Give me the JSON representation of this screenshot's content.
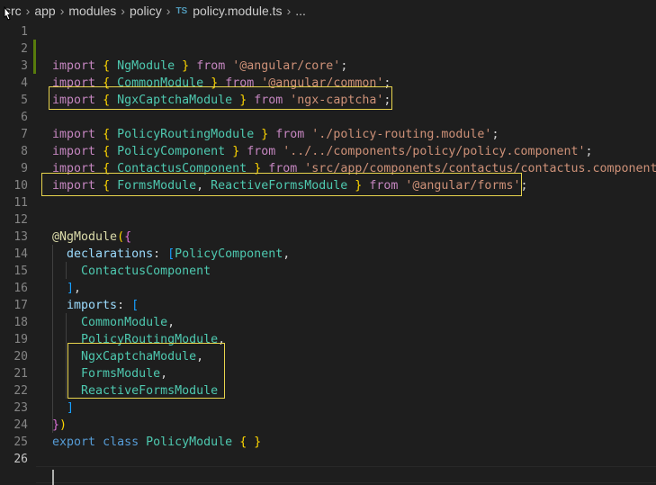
{
  "breadcrumb": {
    "items": [
      "src",
      "app",
      "modules",
      "policy"
    ],
    "file_icon": "TS",
    "file": "policy.module.ts",
    "more": "..."
  },
  "colors": {
    "background": "#1e1e1e",
    "highlight_box": "#e8d44d",
    "keyword": "#c586c0",
    "class_name": "#4ec9b0",
    "string": "#ce9178"
  },
  "editor": {
    "active_line": "26",
    "lines": [
      {
        "n": "1",
        "t": []
      },
      {
        "n": "2",
        "t": []
      },
      {
        "n": "3",
        "t": [
          [
            "kw",
            "import"
          ],
          [
            "pl",
            " "
          ],
          [
            "br1",
            "{"
          ],
          [
            "pl",
            " "
          ],
          [
            "cls",
            "NgModule"
          ],
          [
            "pl",
            " "
          ],
          [
            "br1",
            "}"
          ],
          [
            "pl",
            " "
          ],
          [
            "kw",
            "from"
          ],
          [
            "pl",
            " "
          ],
          [
            "str",
            "'@angular/core'"
          ],
          [
            "pl",
            ";"
          ]
        ]
      },
      {
        "n": "4",
        "t": [
          [
            "kw",
            "import"
          ],
          [
            "pl",
            " "
          ],
          [
            "br1",
            "{"
          ],
          [
            "pl",
            " "
          ],
          [
            "cls",
            "CommonModule"
          ],
          [
            "pl",
            " "
          ],
          [
            "br1",
            "}"
          ],
          [
            "pl",
            " "
          ],
          [
            "kw",
            "from"
          ],
          [
            "pl",
            " "
          ],
          [
            "str",
            "'@angular/common'"
          ],
          [
            "pl",
            ";"
          ]
        ]
      },
      {
        "n": "5",
        "t": [
          [
            "kw",
            "import"
          ],
          [
            "pl",
            " "
          ],
          [
            "br1",
            "{"
          ],
          [
            "pl",
            " "
          ],
          [
            "cls",
            "NgxCaptchaModule"
          ],
          [
            "pl",
            " "
          ],
          [
            "br1",
            "}"
          ],
          [
            "pl",
            " "
          ],
          [
            "kw",
            "from"
          ],
          [
            "pl",
            " "
          ],
          [
            "str",
            "'ngx-captcha'"
          ],
          [
            "pl",
            ";"
          ]
        ]
      },
      {
        "n": "6",
        "t": []
      },
      {
        "n": "7",
        "t": [
          [
            "kw",
            "import"
          ],
          [
            "pl",
            " "
          ],
          [
            "br1",
            "{"
          ],
          [
            "pl",
            " "
          ],
          [
            "cls",
            "PolicyRoutingModule"
          ],
          [
            "pl",
            " "
          ],
          [
            "br1",
            "}"
          ],
          [
            "pl",
            " "
          ],
          [
            "kw",
            "from"
          ],
          [
            "pl",
            " "
          ],
          [
            "str",
            "'./policy-routing.module'"
          ],
          [
            "pl",
            ";"
          ]
        ]
      },
      {
        "n": "8",
        "t": [
          [
            "kw",
            "import"
          ],
          [
            "pl",
            " "
          ],
          [
            "br1",
            "{"
          ],
          [
            "pl",
            " "
          ],
          [
            "cls",
            "PolicyComponent"
          ],
          [
            "pl",
            " "
          ],
          [
            "br1",
            "}"
          ],
          [
            "pl",
            " "
          ],
          [
            "kw",
            "from"
          ],
          [
            "pl",
            " "
          ],
          [
            "str",
            "'../../components/policy/policy.component'"
          ],
          [
            "pl",
            ";"
          ]
        ]
      },
      {
        "n": "9",
        "t": [
          [
            "kw",
            "import"
          ],
          [
            "pl",
            " "
          ],
          [
            "br1",
            "{"
          ],
          [
            "pl",
            " "
          ],
          [
            "cls",
            "ContactusComponent"
          ],
          [
            "pl",
            " "
          ],
          [
            "br1",
            "}"
          ],
          [
            "pl",
            " "
          ],
          [
            "kw",
            "from"
          ],
          [
            "pl",
            " "
          ],
          [
            "str",
            "'src/app/components/contactus/contactus.component'"
          ],
          [
            "pl",
            ";"
          ]
        ]
      },
      {
        "n": "10",
        "t": [
          [
            "kw",
            "import"
          ],
          [
            "pl",
            " "
          ],
          [
            "br1",
            "{"
          ],
          [
            "pl",
            " "
          ],
          [
            "cls",
            "FormsModule"
          ],
          [
            "pl",
            ", "
          ],
          [
            "cls",
            "ReactiveFormsModule"
          ],
          [
            "pl",
            " "
          ],
          [
            "br1",
            "}"
          ],
          [
            "pl",
            " "
          ],
          [
            "kw",
            "from"
          ],
          [
            "pl",
            " "
          ],
          [
            "str",
            "'@angular/forms'"
          ],
          [
            "pl",
            ";"
          ]
        ]
      },
      {
        "n": "11",
        "t": []
      },
      {
        "n": "12",
        "t": []
      },
      {
        "n": "13",
        "t": [
          [
            "fn",
            "@"
          ],
          [
            "fn",
            "NgModule"
          ],
          [
            "br1",
            "("
          ],
          [
            "br2",
            "{"
          ]
        ]
      },
      {
        "n": "14",
        "t": [
          [
            "pl",
            "  "
          ],
          [
            "id",
            "declarations"
          ],
          [
            "pl",
            ": "
          ],
          [
            "br3",
            "["
          ],
          [
            "cls",
            "PolicyComponent"
          ],
          [
            "pl",
            ","
          ]
        ]
      },
      {
        "n": "15",
        "t": [
          [
            "pl",
            "    "
          ],
          [
            "cls",
            "ContactusComponent"
          ]
        ]
      },
      {
        "n": "16",
        "t": [
          [
            "pl",
            "  "
          ],
          [
            "br3",
            "]"
          ],
          [
            "pl",
            ","
          ]
        ]
      },
      {
        "n": "17",
        "t": [
          [
            "pl",
            "  "
          ],
          [
            "id",
            "imports"
          ],
          [
            "pl",
            ": "
          ],
          [
            "br3",
            "["
          ]
        ]
      },
      {
        "n": "18",
        "t": [
          [
            "pl",
            "    "
          ],
          [
            "cls",
            "CommonModule"
          ],
          [
            "pl",
            ","
          ]
        ]
      },
      {
        "n": "19",
        "t": [
          [
            "pl",
            "    "
          ],
          [
            "cls",
            "PolicyRoutingModule"
          ],
          [
            "pl",
            ","
          ]
        ]
      },
      {
        "n": "20",
        "t": [
          [
            "pl",
            "    "
          ],
          [
            "cls",
            "NgxCaptchaModule"
          ],
          [
            "pl",
            ","
          ]
        ]
      },
      {
        "n": "21",
        "t": [
          [
            "pl",
            "    "
          ],
          [
            "cls",
            "FormsModule"
          ],
          [
            "pl",
            ","
          ]
        ]
      },
      {
        "n": "22",
        "t": [
          [
            "pl",
            "    "
          ],
          [
            "cls",
            "ReactiveFormsModule"
          ]
        ]
      },
      {
        "n": "23",
        "t": [
          [
            "pl",
            "  "
          ],
          [
            "br3",
            "]"
          ]
        ]
      },
      {
        "n": "24",
        "t": [
          [
            "br2",
            "}"
          ],
          [
            "br1",
            ")"
          ]
        ]
      },
      {
        "n": "25",
        "t": [
          [
            "kw2",
            "export"
          ],
          [
            "pl",
            " "
          ],
          [
            "kw2",
            "class"
          ],
          [
            "pl",
            " "
          ],
          [
            "cls",
            "PolicyModule"
          ],
          [
            "pl",
            " "
          ],
          [
            "br1",
            "{"
          ],
          [
            "pl",
            " "
          ],
          [
            "br1",
            "}"
          ]
        ]
      },
      {
        "n": "26",
        "t": []
      }
    ]
  }
}
